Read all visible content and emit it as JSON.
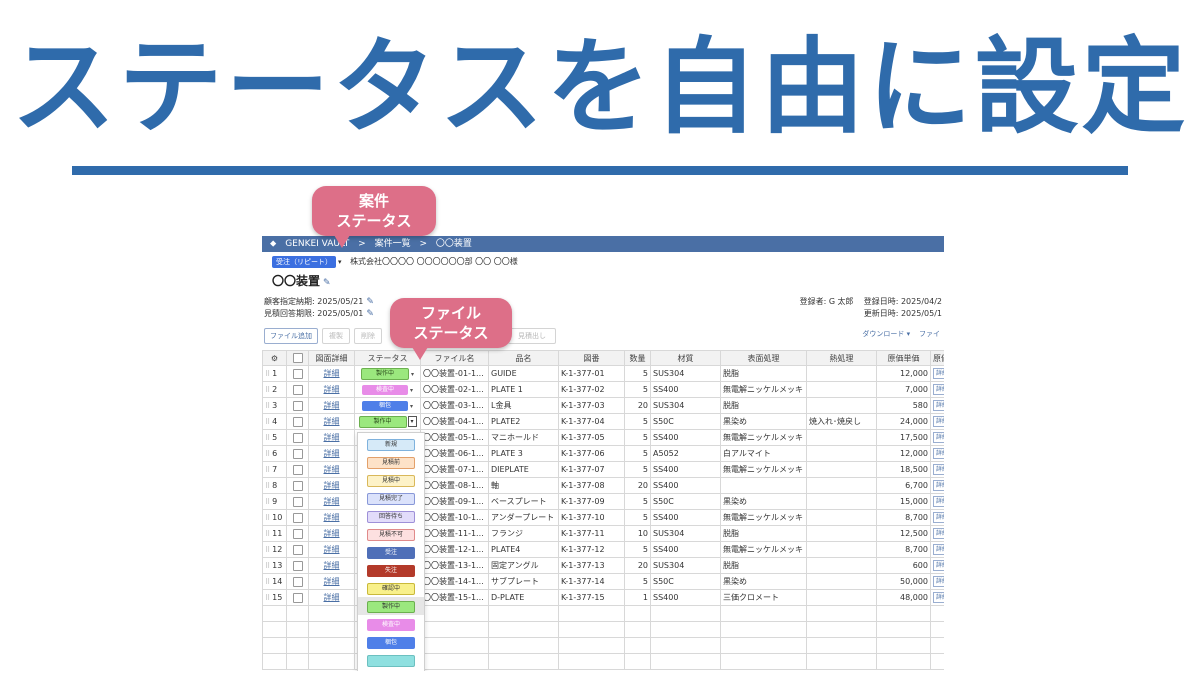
{
  "headline": "ステータスを自由に設定",
  "callouts": {
    "project_status": [
      "案件",
      "ステータス"
    ],
    "file_status": [
      "ファイル",
      "ステータス"
    ]
  },
  "colors": {
    "brand_blue": "#2f6bab",
    "callout_pink": "#dd6f88",
    "topbar": "#4a6fa5"
  },
  "app": {
    "breadcrumb": [
      "GENKEI VAULT",
      "案件一覧",
      "〇〇装置"
    ],
    "breadcrumb_sep": ">",
    "project_status": "受注（リピート）",
    "customer": "株式会社〇〇〇〇 〇〇〇〇〇〇部 〇〇 〇〇様",
    "project_title": "〇〇装置",
    "due_date": "顧客指定納期: 2025/05/21",
    "quote_deadline": "見積回答期限: 2025/05/01",
    "registrant": "登録者: G 太郎",
    "registered_at": "登録日時: 2025/04/2",
    "updated_at": "更新日時: 2025/05/1",
    "toolbar": {
      "add_file": "ファイル追加",
      "copy": "複製",
      "delete": "削除",
      "quote": "見積出し",
      "download": "ダウンロード ▾",
      "file_menu": "ファイ"
    },
    "columns": [
      "図面詳細",
      "ステータス",
      "ファイル名",
      "品名",
      "図番",
      "数量",
      "材質",
      "表面処理",
      "熱処理",
      "原価単価",
      "原価"
    ],
    "detail_label": "詳細",
    "rows": [
      {
        "no": "1",
        "status": "製作中",
        "status_style": "green",
        "file": "〇〇装置-01-1...",
        "name": "GUIDE",
        "drawing": "K-1-377-01",
        "qty": "5",
        "material": "SUS304",
        "surface": "脱脂",
        "heat": "",
        "cost": "12,000"
      },
      {
        "no": "2",
        "status": "検査中",
        "status_style": "pink",
        "file": "〇〇装置-02-1...",
        "name": "PLATE 1",
        "drawing": "K-1-377-02",
        "qty": "5",
        "material": "SS400",
        "surface": "無電解ニッケルメッキ",
        "heat": "",
        "cost": "7,000"
      },
      {
        "no": "3",
        "status": "梱包",
        "status_style": "blue",
        "file": "〇〇装置-03-1...",
        "name": "L金具",
        "drawing": "K-1-377-03",
        "qty": "20",
        "material": "SUS304",
        "surface": "脱脂",
        "heat": "",
        "cost": "580"
      },
      {
        "no": "4",
        "status": "製作中",
        "status_style": "green",
        "file": "〇〇装置-04-1...",
        "name": "PLATE2",
        "drawing": "K-1-377-04",
        "qty": "5",
        "material": "S50C",
        "surface": "黒染め",
        "heat": "焼入れ･焼戻し",
        "cost": "24,000"
      },
      {
        "no": "5",
        "status": "",
        "status_style": "",
        "file": "〇〇装置-05-1...",
        "name": "マニホールド",
        "drawing": "K-1-377-05",
        "qty": "5",
        "material": "SS400",
        "surface": "無電解ニッケルメッキ",
        "heat": "",
        "cost": "17,500"
      },
      {
        "no": "6",
        "status": "",
        "status_style": "",
        "file": "〇〇装置-06-1...",
        "name": "PLATE 3",
        "drawing": "K-1-377-06",
        "qty": "5",
        "material": "A5052",
        "surface": "白アルマイト",
        "heat": "",
        "cost": "12,000"
      },
      {
        "no": "7",
        "status": "",
        "status_style": "",
        "file": "〇〇装置-07-1...",
        "name": "DIEPLATE",
        "drawing": "K-1-377-07",
        "qty": "5",
        "material": "SS400",
        "surface": "無電解ニッケルメッキ",
        "heat": "",
        "cost": "18,500"
      },
      {
        "no": "8",
        "status": "",
        "status_style": "",
        "file": "〇〇装置-08-1...",
        "name": "軸",
        "drawing": "K-1-377-08",
        "qty": "20",
        "material": "SS400",
        "surface": "",
        "heat": "",
        "cost": "6,700"
      },
      {
        "no": "9",
        "status": "",
        "status_style": "",
        "file": "〇〇装置-09-1...",
        "name": "ベースプレート",
        "drawing": "K-1-377-09",
        "qty": "5",
        "material": "S50C",
        "surface": "黒染め",
        "heat": "",
        "cost": "15,000"
      },
      {
        "no": "10",
        "status": "",
        "status_style": "",
        "file": "〇〇装置-10-1...",
        "name": "アンダープレート",
        "drawing": "K-1-377-10",
        "qty": "5",
        "material": "SS400",
        "surface": "無電解ニッケルメッキ",
        "heat": "",
        "cost": "8,700"
      },
      {
        "no": "11",
        "status": "",
        "status_style": "",
        "file": "〇〇装置-11-1...",
        "name": "フランジ",
        "drawing": "K-1-377-11",
        "qty": "10",
        "material": "SUS304",
        "surface": "脱脂",
        "heat": "",
        "cost": "12,500"
      },
      {
        "no": "12",
        "status": "",
        "status_style": "",
        "file": "〇〇装置-12-1...",
        "name": "PLATE4",
        "drawing": "K-1-377-12",
        "qty": "5",
        "material": "SS400",
        "surface": "無電解ニッケルメッキ",
        "heat": "",
        "cost": "8,700"
      },
      {
        "no": "13",
        "status": "",
        "status_style": "",
        "file": "〇〇装置-13-1...",
        "name": "固定アングル",
        "drawing": "K-1-377-13",
        "qty": "20",
        "material": "SUS304",
        "surface": "脱脂",
        "heat": "",
        "cost": "600"
      },
      {
        "no": "14",
        "status": "",
        "status_style": "",
        "file": "〇〇装置-14-1...",
        "name": "サブプレート",
        "drawing": "K-1-377-14",
        "qty": "5",
        "material": "S50C",
        "surface": "黒染め",
        "heat": "",
        "cost": "50,000"
      },
      {
        "no": "15",
        "status": "",
        "status_style": "",
        "file": "〇〇装置-15-1...",
        "name": "D-PLATE",
        "drawing": "K-1-377-15",
        "qty": "1",
        "material": "SS400",
        "surface": "三価クロメート",
        "heat": "",
        "cost": "48,000"
      }
    ],
    "status_options": [
      {
        "label": "新規",
        "bg": "#d6eaf8",
        "border": "#7fb2dd",
        "color": "#333"
      },
      {
        "label": "見積前",
        "bg": "#fde2c8",
        "border": "#e3a06a",
        "color": "#333"
      },
      {
        "label": "見積中",
        "bg": "#fdf2c8",
        "border": "#d9b85a",
        "color": "#333"
      },
      {
        "label": "見積完了",
        "bg": "#dbe2fb",
        "border": "#8898d8",
        "color": "#333"
      },
      {
        "label": "回答待ち",
        "bg": "#e2dcfa",
        "border": "#9e90d8",
        "color": "#333"
      },
      {
        "label": "見積不可",
        "bg": "#fde0e0",
        "border": "#e08a8a",
        "color": "#333"
      },
      {
        "label": "受注",
        "bg": "#4f6fb8",
        "border": "#4f6fb8",
        "color": "#fff"
      },
      {
        "label": "失注",
        "bg": "#b33a2a",
        "border": "#b33a2a",
        "color": "#fff"
      },
      {
        "label": "確認中",
        "bg": "#f8f08a",
        "border": "#c9b93a",
        "color": "#333"
      },
      {
        "label": "製作中",
        "bg": "#9be87e",
        "border": "#6cb04f",
        "color": "#333",
        "selected": true
      },
      {
        "label": "検査中",
        "bg": "#e88ce8",
        "border": "#e88ce8",
        "color": "#fff"
      },
      {
        "label": "梱包",
        "bg": "#4f7fe8",
        "border": "#4f7fe8",
        "color": "#fff"
      },
      {
        "label": "",
        "bg": "#8fe0e0",
        "border": "#6cc0c0",
        "color": "#333"
      }
    ]
  }
}
